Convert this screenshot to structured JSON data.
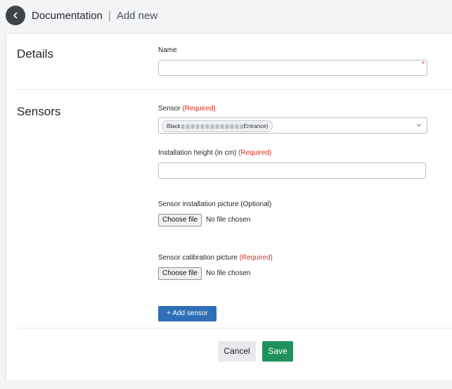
{
  "header": {
    "section": "Documentation",
    "separator": "|",
    "page": "Add new"
  },
  "details": {
    "title": "Details",
    "name_label": "Name",
    "name_value": "",
    "required_marker": "*"
  },
  "sensors": {
    "title": "Sensors",
    "sensor_label": "Sensor",
    "sensor_required": "(Required)",
    "sensor_chip_start": "Black",
    "sensor_chip_end": "Entrance)",
    "height_label": "Installation height (in cm)",
    "height_required": "(Required)",
    "height_value": "",
    "install_pic_label": "Sensor installation picture (Optional)",
    "install_pic_button": "Choose file",
    "install_pic_status": "No file chosen",
    "calib_pic_label": "Sensor calibration picture",
    "calib_pic_required": "(Required)",
    "calib_pic_button": "Choose file",
    "calib_pic_status": "No file chosen",
    "add_sensor_label": "+ Add sensor"
  },
  "footer": {
    "cancel_label": "Cancel",
    "save_label": "Save"
  },
  "colors": {
    "accent_blue": "#2f6fb7",
    "save_green": "#21915c",
    "required_red": "#d92d20"
  }
}
